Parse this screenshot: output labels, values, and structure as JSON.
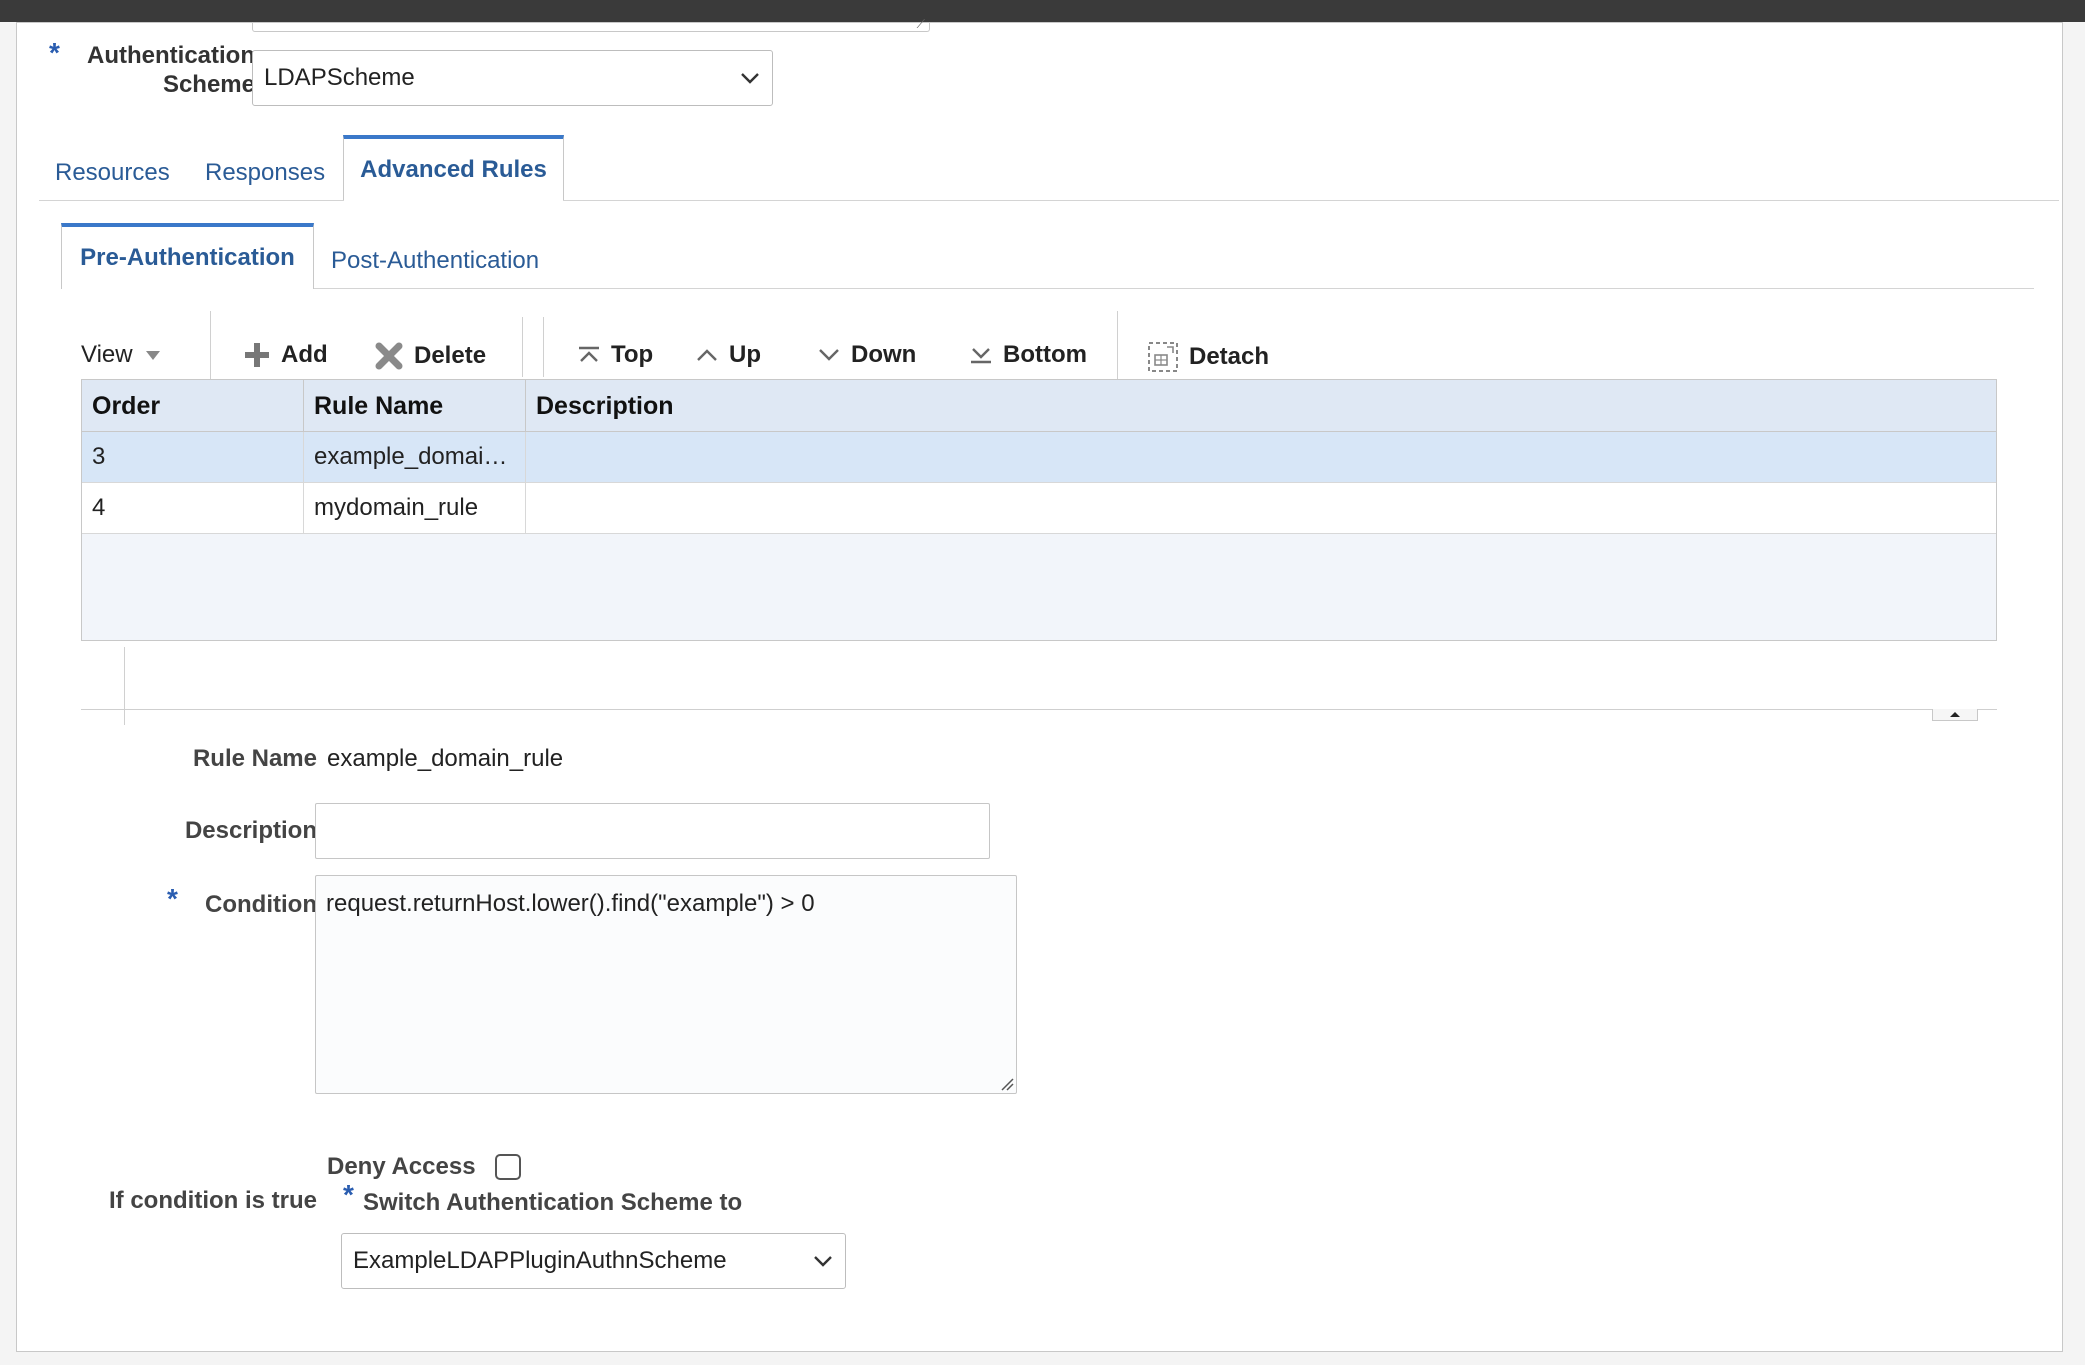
{
  "auth_scheme": {
    "label_line1": "Authentication",
    "label_line2": "Scheme",
    "required_mark": "*",
    "value": "LDAPScheme"
  },
  "tabs": [
    {
      "label": "Resources"
    },
    {
      "label": "Responses"
    },
    {
      "label": "Advanced Rules",
      "active": true
    }
  ],
  "subtabs": [
    {
      "label": "Pre-Authentication",
      "active": true
    },
    {
      "label": "Post-Authentication"
    }
  ],
  "toolbar": {
    "view": "View",
    "add": "Add",
    "delete": "Delete",
    "top": "Top",
    "up": "Up",
    "down": "Down",
    "bottom": "Bottom",
    "detach": "Detach"
  },
  "table": {
    "columns": [
      "Order",
      "Rule Name",
      "Description"
    ],
    "rows": [
      {
        "order": "3",
        "rule_name": "example_domai…",
        "description": "",
        "selected": true
      },
      {
        "order": "4",
        "rule_name": "mydomain_rule",
        "description": ""
      }
    ]
  },
  "details": {
    "rule_name_label": "Rule Name",
    "rule_name_value": "example_domain_rule",
    "description_label": "Description",
    "description_value": "",
    "condition_label": "Condition",
    "condition_value": "request.returnHost.lower().find(\"example\") > 0",
    "if_true_label": "If condition is true",
    "deny_access_label": "Deny Access",
    "deny_access_checked": false,
    "switch_label": "Switch Authentication Scheme to",
    "switch_value": "ExampleLDAPPluginAuthnScheme",
    "required_mark": "*"
  },
  "colors": {
    "accent": "#3a78c9",
    "link": "#2a5b96",
    "header_bg": "#dfe8f4",
    "selected_row": "#d7e6f7"
  }
}
